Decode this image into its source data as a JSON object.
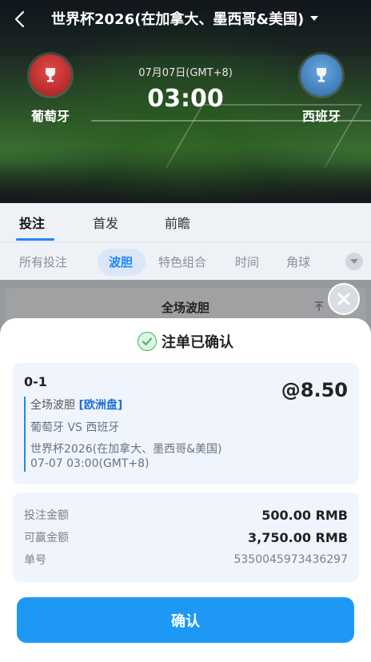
{
  "header": {
    "title": "世界杯2026(在加拿大、墨西哥&美国)"
  },
  "match": {
    "home_team": "葡萄牙",
    "away_team": "西班牙",
    "date": "07月07日(GMT+8)",
    "time": "03:00"
  },
  "tabs": [
    {
      "label": "投注"
    },
    {
      "label": "首发"
    },
    {
      "label": "前瞻"
    }
  ],
  "subtabs": [
    {
      "label": "所有投注"
    },
    {
      "label": "波胆"
    },
    {
      "label": "特色组合"
    },
    {
      "label": "时间"
    },
    {
      "label": "角球"
    }
  ],
  "panel": {
    "title": "全场波胆"
  },
  "receipt": {
    "status": "注单已确认",
    "selection": "0-1",
    "odds": "@8.50",
    "market": "全场波胆",
    "market_tag": "[欧洲盘]",
    "teams": "葡萄牙 VS 西班牙",
    "league": "世界杯2026(在加拿大、墨西哥&美国)",
    "kickoff": "07-07 03:00(GMT+8)",
    "stake_label": "投注金额",
    "stake_value": "500.00 RMB",
    "win_label": "可赢金额",
    "win_value": "3,750.00 RMB",
    "ticket_label": "单号",
    "ticket_value": "5350045973436297",
    "confirm_label": "确认"
  },
  "colors": {
    "accent": "#1e98f5",
    "success": "#3bb55b"
  }
}
